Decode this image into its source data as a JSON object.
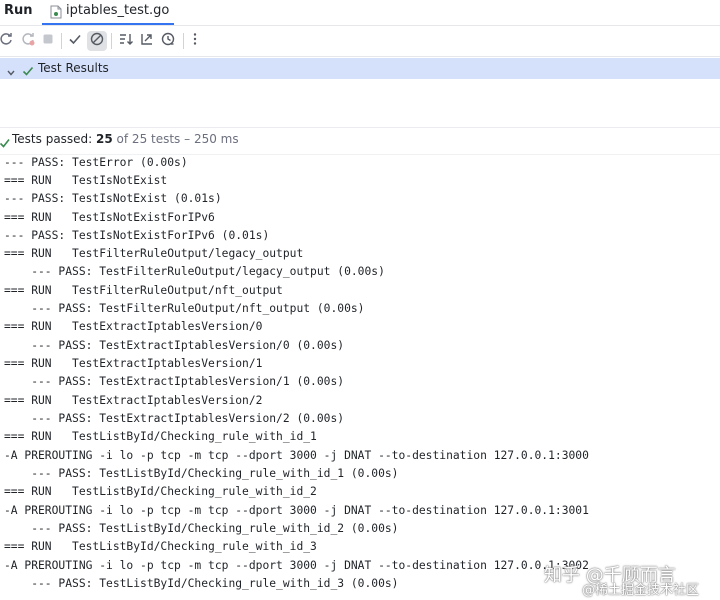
{
  "header": {
    "run_label": "Run",
    "tab_label": "iptables_test.go"
  },
  "toolbar": {
    "buttons": [
      "rerun-icon",
      "rerun-failed-icon",
      "stop-icon",
      "show-passed-icon",
      "show-ignored-icon",
      "sort-alpha-icon",
      "collapse-icon",
      "history-icon",
      "more-icon"
    ]
  },
  "tree": {
    "root_label": "Test Results"
  },
  "status": {
    "prefix": "Tests passed: ",
    "passed": "25",
    "rest": " of 25 tests – 250 ms"
  },
  "console": {
    "lines": [
      "--- PASS: TestError (0.00s)",
      "=== RUN   TestIsNotExist",
      "--- PASS: TestIsNotExist (0.01s)",
      "=== RUN   TestIsNotExistForIPv6",
      "--- PASS: TestIsNotExistForIPv6 (0.01s)",
      "=== RUN   TestFilterRuleOutput/legacy_output",
      "    --- PASS: TestFilterRuleOutput/legacy_output (0.00s)",
      "=== RUN   TestFilterRuleOutput/nft_output",
      "    --- PASS: TestFilterRuleOutput/nft_output (0.00s)",
      "=== RUN   TestExtractIptablesVersion/0",
      "    --- PASS: TestExtractIptablesVersion/0 (0.00s)",
      "=== RUN   TestExtractIptablesVersion/1",
      "    --- PASS: TestExtractIptablesVersion/1 (0.00s)",
      "=== RUN   TestExtractIptablesVersion/2",
      "    --- PASS: TestExtractIptablesVersion/2 (0.00s)",
      "=== RUN   TestListById/Checking_rule_with_id_1",
      "-A PREROUTING -i lo -p tcp -m tcp --dport 3000 -j DNAT --to-destination 127.0.0.1:3000",
      "    --- PASS: TestListById/Checking_rule_with_id_1 (0.00s)",
      "=== RUN   TestListById/Checking_rule_with_id_2",
      "-A PREROUTING -i lo -p tcp -m tcp --dport 3000 -j DNAT --to-destination 127.0.0.1:3001",
      "    --- PASS: TestListById/Checking_rule_with_id_2 (0.00s)",
      "=== RUN   TestListById/Checking_rule_with_id_3",
      "-A PREROUTING -i lo -p tcp -m tcp --dport 3000 -j DNAT --to-destination 127.0.0.1:3002",
      "    --- PASS: TestListById/Checking_rule_with_id_3 (0.00s)"
    ]
  },
  "watermark": {
    "line1": "知乎 @千顾而言",
    "line2": "@稀土掘金技术社区"
  },
  "colors": {
    "accent": "#3574f0",
    "success": "#3b8a4f",
    "selection": "#d5e1fb"
  }
}
